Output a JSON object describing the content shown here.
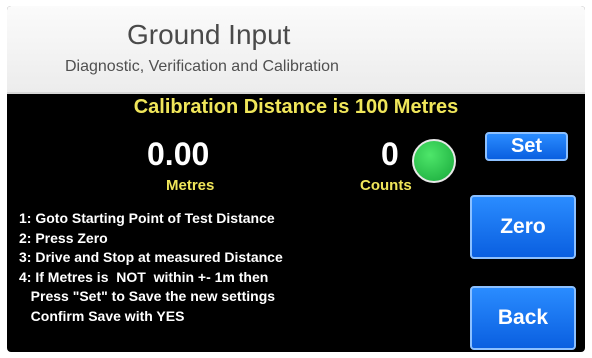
{
  "header": {
    "title": "Ground Input",
    "subtitle": "Diagnostic, Verification and Calibration"
  },
  "calibration_text": "Calibration Distance is 100 Metres",
  "metres": {
    "value": "0.00",
    "label": "Metres"
  },
  "counts": {
    "value": "0",
    "label": "Counts"
  },
  "status_indicator": {
    "color": "#22c24a",
    "state": "ok"
  },
  "buttons": {
    "set": "Set",
    "zero": "Zero",
    "back": "Back"
  },
  "instructions": [
    "1: Goto Starting Point of Test Distance",
    "2: Press Zero",
    "3: Drive and Stop at measured Distance",
    "4: If Metres is  NOT  within +- 1m then",
    "   Press \"Set\" to Save the new settings",
    "   Confirm Save with YES"
  ],
  "colors": {
    "accent_text": "#f0e65a",
    "button_blue": "#1a7af0",
    "background": "#000000"
  }
}
